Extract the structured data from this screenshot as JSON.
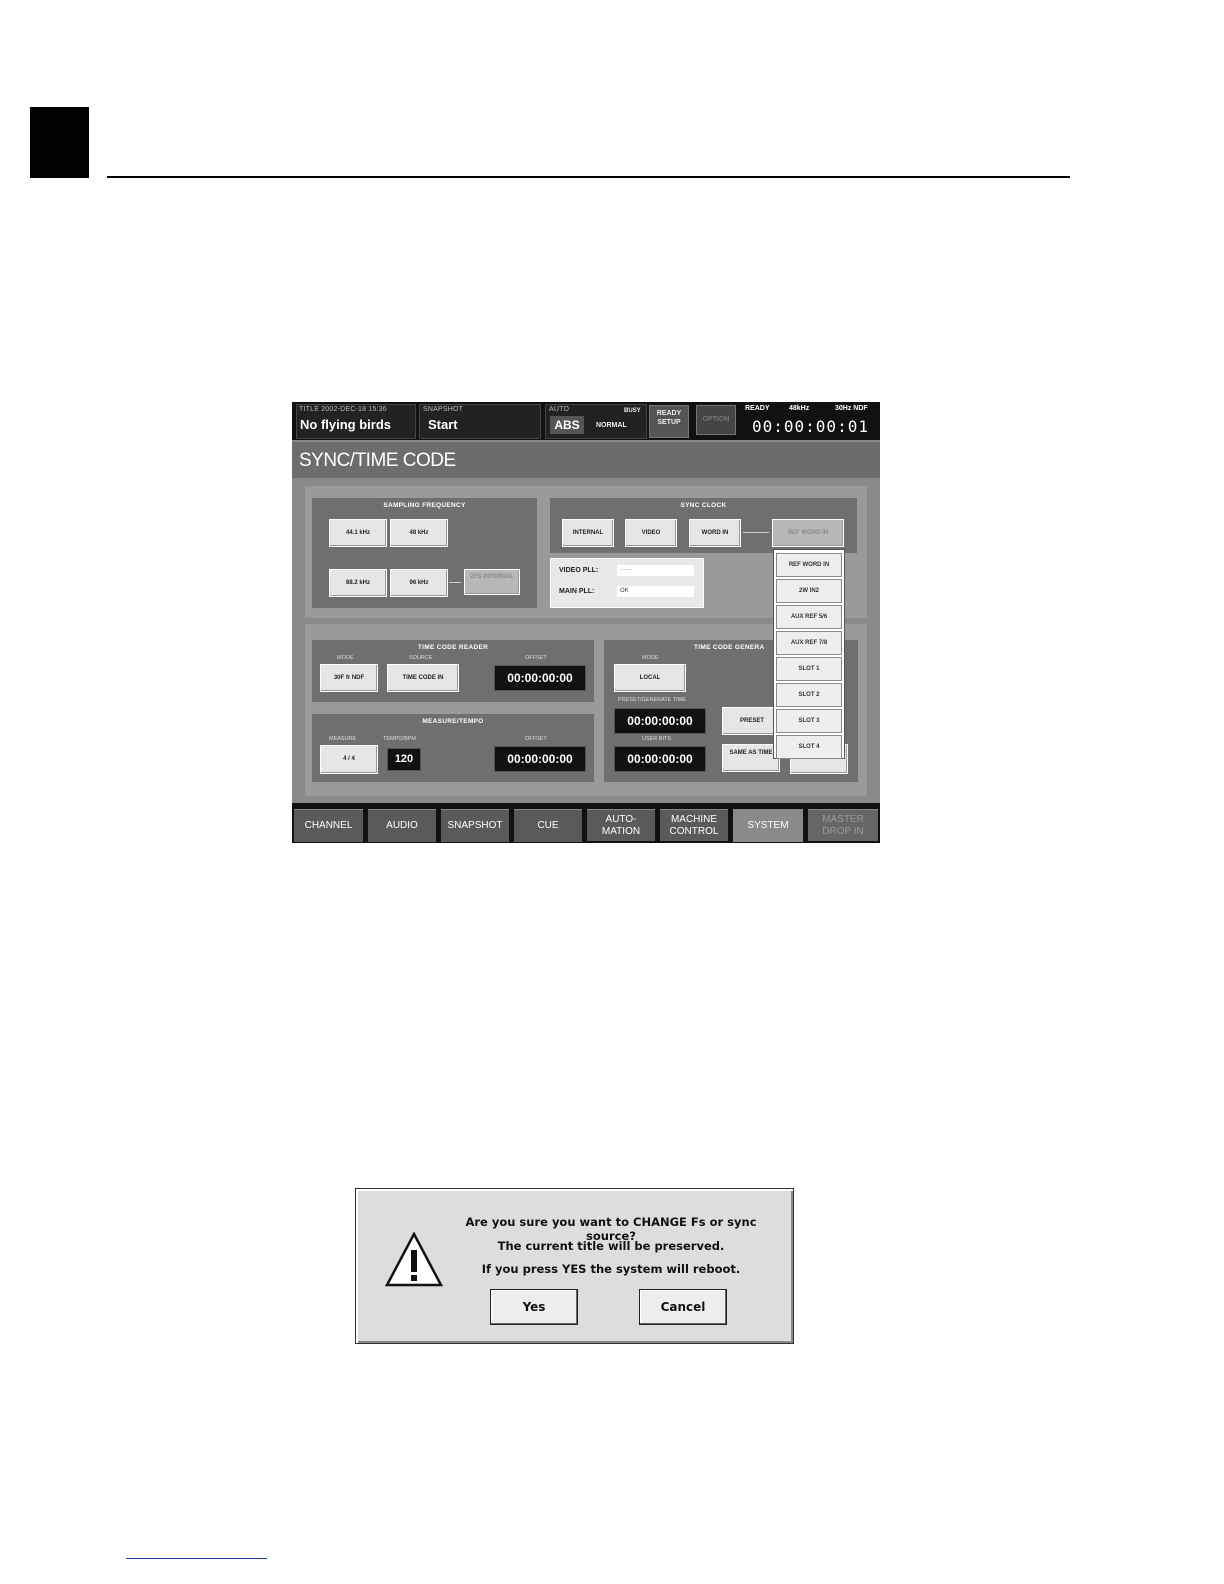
{
  "screen": {
    "topbar": {
      "title_label": "TITLE 2002-DEC-18 15:36",
      "title_value": "No flying birds",
      "snapshot_label": "SNAPSHOT",
      "snapshot_value": "Start",
      "auto_label": "AUTO",
      "auto_value": "ABS",
      "auto_mode": "NORMAL",
      "auto_extra": "BUSY",
      "ready_setup": "READY SETUP",
      "option": "OPTION",
      "status_ready": "READY",
      "status_rate": "48kHz",
      "status_fps": "30Hz NDF",
      "timecode": "00:00:00:01"
    },
    "page_title": "SYNC/TIME CODE",
    "sampling_frequency": {
      "label": "SAMPLING FREQUENCY",
      "buttons": [
        "44.1 kHz",
        "48 kHz",
        "88.2 kHz",
        "96 kHz",
        "2FS INTERNAL"
      ]
    },
    "sync_clock": {
      "label": "SYNC CLOCK",
      "buttons": [
        "INTERNAL",
        "VIDEO",
        "WORD IN",
        "REF WORD IN"
      ]
    },
    "pll": {
      "video_label": "VIDEO PLL:",
      "video_value": "------",
      "main_label": "MAIN PLL:",
      "main_value": "OK"
    },
    "dropdown": {
      "items": [
        "REF WORD IN",
        "2W IN2",
        "AUX REF 5/6",
        "AUX REF 7/8",
        "SLOT 1",
        "SLOT 2",
        "SLOT 3",
        "SLOT 4"
      ]
    },
    "tc_reader": {
      "label": "TIME CODE READER",
      "mode_label": "MODE",
      "mode_value": "30F fr NDF",
      "source_label": "SOURCE",
      "source_value": "TIME CODE IN",
      "offset_label": "OFFSET",
      "offset_value": "00:00:00:00"
    },
    "tc_generator": {
      "label": "TIME CODE GENERA",
      "mode_label": "MODE",
      "mode_value": "LOCAL",
      "preset_label": "PRESET/GENERATE TIME",
      "preset_value": "00:00:00:00",
      "preset_button": "PRESET",
      "userbits_label": "USER BITS",
      "userbits_value": "00:00:00:00",
      "same_button": "SAME AS TIME"
    },
    "measure_tempo": {
      "label": "MEASURE/TEMPO",
      "measure_label": "MEASURE",
      "measure_value": "4 / 4",
      "tempo_label": "TEMPO/BPM",
      "tempo_value": "120",
      "offset_label": "OFFSET",
      "offset_value": "00:00:00:00"
    },
    "bottom_tabs": [
      "CHANNEL",
      "AUDIO",
      "SNAPSHOT",
      "CUE",
      "AUTO-\nMATION",
      "MACHINE\nCONTROL",
      "SYSTEM",
      "MASTER\nDROP IN"
    ]
  },
  "dialog": {
    "line1": "Are you sure you want to CHANGE Fs or sync source?",
    "line2": "The current title will be preserved.",
    "line3": "If you press YES the system will reboot.",
    "yes": "Yes",
    "cancel": "Cancel"
  }
}
